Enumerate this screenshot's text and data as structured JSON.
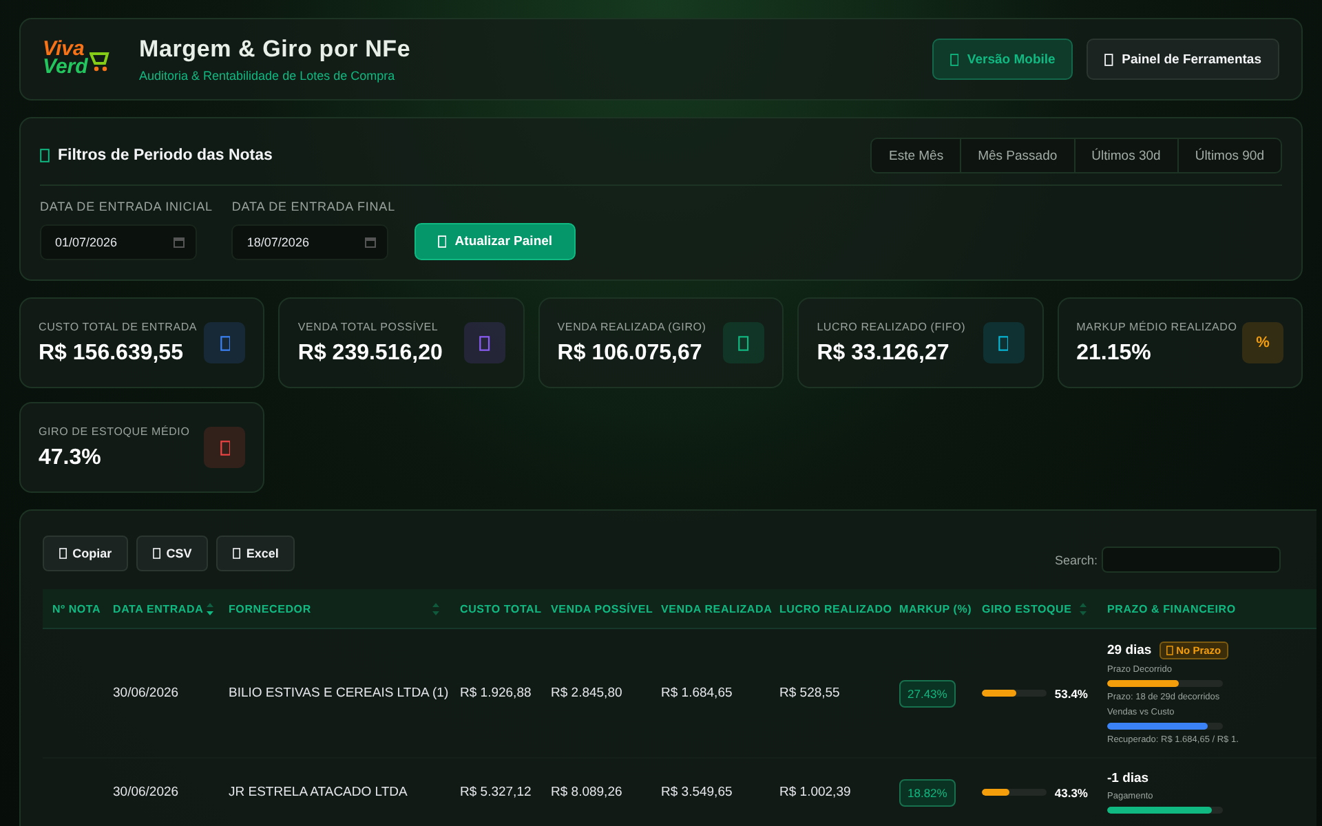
{
  "header": {
    "logo": {
      "line_1": "Viva",
      "line_2": "Verd"
    },
    "title": "Margem & Giro por NFe",
    "subtitle": "Auditoria & Rentabilidade de Lotes de Compra",
    "buttons": [
      {
        "label": "Versão Mobile",
        "kind": "accent"
      },
      {
        "label": "Painel de Ferramentas",
        "kind": "plain"
      }
    ]
  },
  "filters": {
    "title": "Filtros de Periodo das Notas",
    "periods": [
      {
        "label": "Este Mês",
        "selected": false
      },
      {
        "label": "Mês Passado",
        "selected": false
      },
      {
        "label": "Últimos 30d",
        "selected": false
      },
      {
        "label": "Últimos 90d",
        "selected": false
      }
    ],
    "fields": [
      {
        "label": "DATA DE ENTRADA INICIAL",
        "value": "01/07/2026"
      },
      {
        "label": "DATA DE ENTRADA FINAL",
        "value": "18/07/2026"
      }
    ],
    "button": "Atualizar Painel"
  },
  "kpis": [
    {
      "label": "CUSTO TOTAL DE ENTRADA",
      "value": "R$ 156.639,55",
      "color": "#3b82f6"
    },
    {
      "label": "VENDA TOTAL POSSÍVEL",
      "value": "R$ 239.516,20",
      "color": "#8b5cf6"
    },
    {
      "label": "VENDA REALIZADA (GIRO)",
      "value": "R$ 106.075,67",
      "color": "#10b981"
    },
    {
      "label": "LUCRO REALIZADO (FIFO)",
      "value": "R$ 33.126,27",
      "color": "#06b6d4"
    },
    {
      "label": "MARKUP MÉDIO REALIZADO",
      "value": "21.15%",
      "color": "#f59e0b",
      "glyph": "%"
    },
    {
      "label": "GIRO DE ESTOQUE MÉDIO",
      "value": "47.3%",
      "color": "#ef4444"
    }
  ],
  "table": {
    "export_buttons": [
      "Copiar",
      "CSV",
      "Excel"
    ],
    "search_label": "Search:",
    "columns": [
      {
        "label": "Nº NOTA"
      },
      {
        "label": "DATA ENTRADA",
        "sortable": true,
        "sorted": true
      },
      {
        "label": "FORNECEDOR",
        "sortable": true,
        "sorted": false
      },
      {
        "label": "CUSTO TOTAL"
      },
      {
        "label": "VENDA POSSÍVEL"
      },
      {
        "label": "VENDA REALIZADA"
      },
      {
        "label": "LUCRO REALIZADO"
      },
      {
        "label": "MARKUP (%)"
      },
      {
        "label": "GIRO ESTOQUE",
        "sortable": true,
        "sorted": false
      },
      {
        "label": "PRAZO & FINANCEIRO"
      }
    ],
    "rows": [
      {
        "date": "30/06/2026",
        "supplier": "BILIO ESTIVAS E CEREAIS LTDA (1)",
        "cost": "R$ 1.926,88",
        "possible": "R$ 2.845,80",
        "realized": "R$ 1.684,65",
        "profit": "R$ 528,55",
        "markup": "27.43%",
        "turnover": {
          "level": 0.534,
          "reading": "53.4%"
        },
        "term": {
          "days": "29 dias",
          "badge": "No Prazo",
          "bars": [
            {
              "label": "Prazo Decorrido",
              "level": 0.62,
              "color": "#f59e0b",
              "note": "Prazo: 18 de 29d decorridos"
            },
            {
              "label": "Vendas vs Custo",
              "level": 0.87,
              "color": "#3b82f6",
              "note": "Recuperado: R$ 1.684,65 / R$ 1."
            }
          ]
        }
      },
      {
        "date": "30/06/2026",
        "supplier": "JR ESTRELA ATACADO LTDA",
        "cost": "R$ 5.327,12",
        "possible": "R$ 8.089,26",
        "realized": "R$ 3.549,65",
        "profit": "R$ 1.002,39",
        "markup": "18.82%",
        "turnover": {
          "level": 0.433,
          "reading": "43.3%"
        },
        "term": {
          "days": "-1 dias",
          "bars": [
            {
              "label": "Pagamento",
              "level": 0.9,
              "color": "#10b981"
            }
          ]
        }
      }
    ]
  }
}
